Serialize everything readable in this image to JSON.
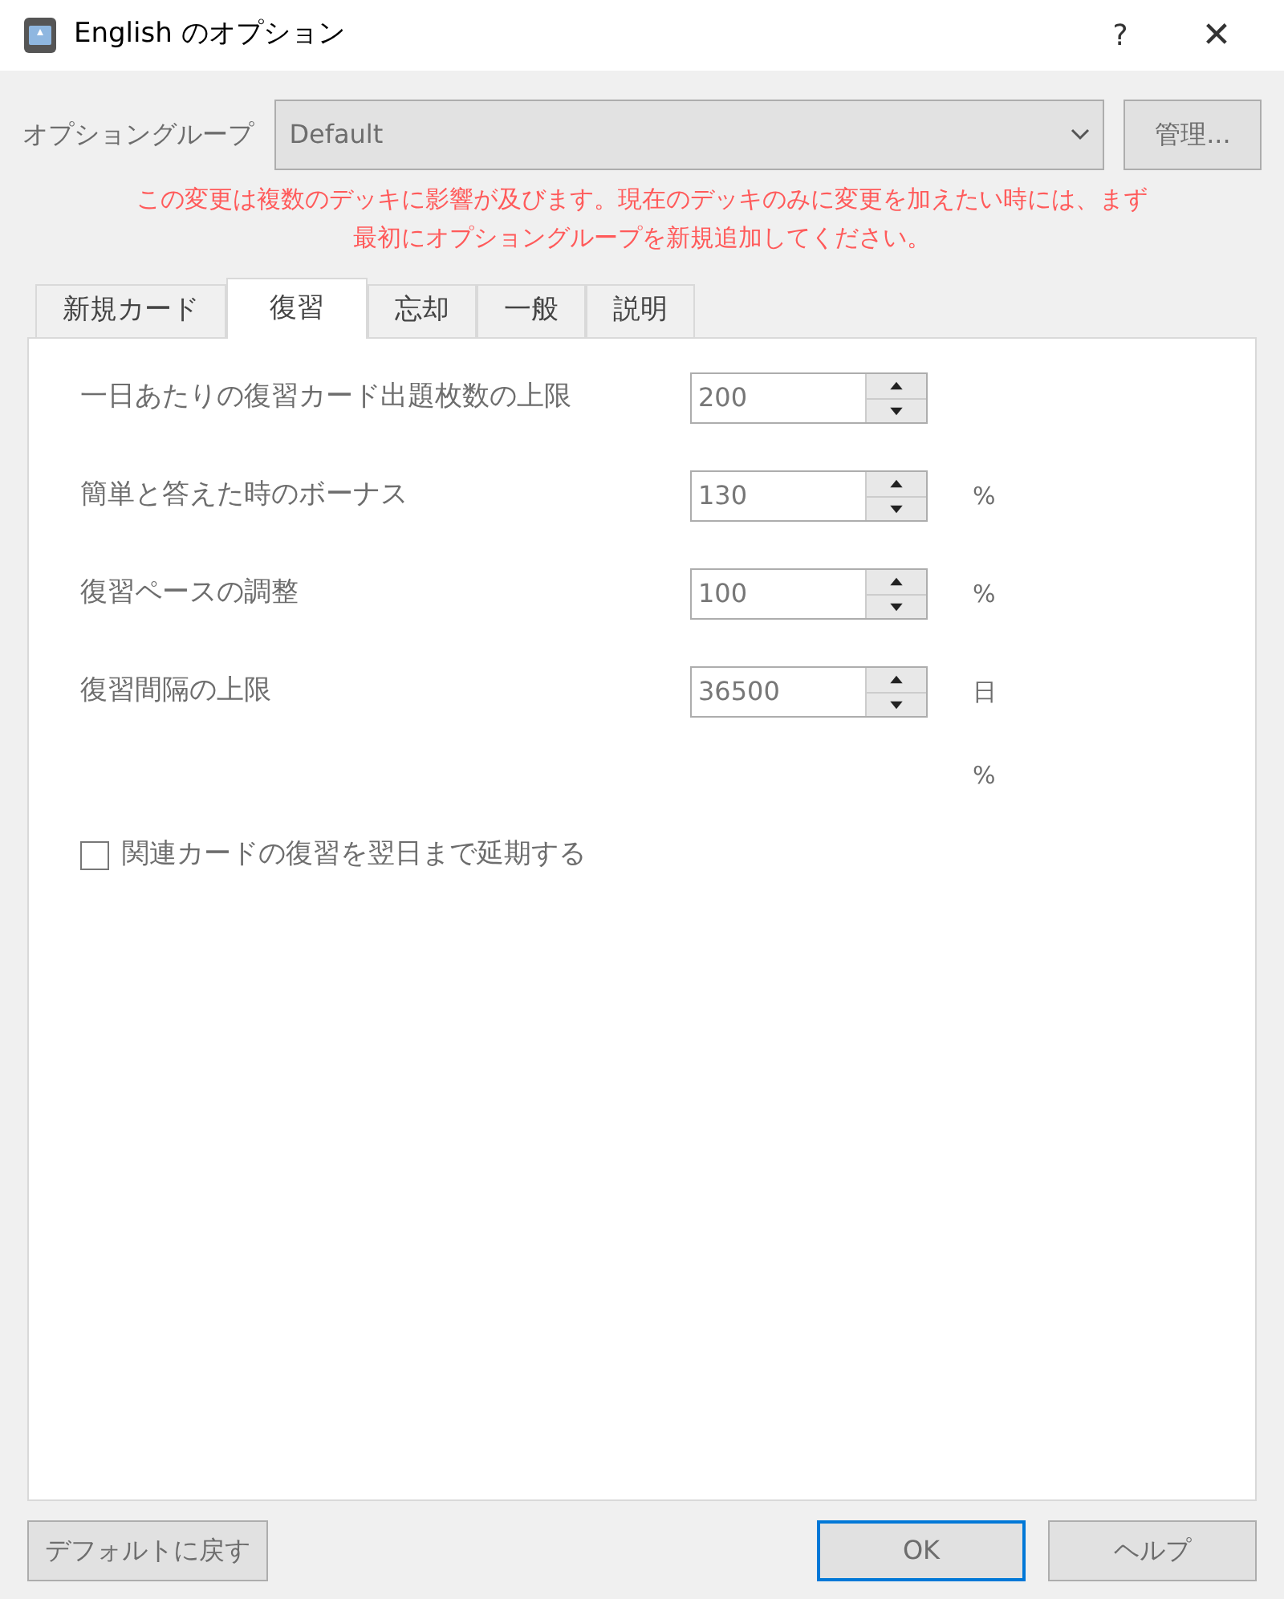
{
  "window": {
    "title": "English のオプション",
    "help": "?",
    "close": "✕"
  },
  "option_group": {
    "label": "オプショングループ",
    "value": "Default",
    "manage_button": "管理..."
  },
  "warning": [
    "この変更は複数のデッキに影響が及びます。現在のデッキのみに変更を加えたい時には、まず",
    "最初にオプショングループを新規追加してください。"
  ],
  "tabs": [
    {
      "label": "新規カード",
      "selected": false
    },
    {
      "label": "復習",
      "selected": true
    },
    {
      "label": "忘却",
      "selected": false
    },
    {
      "label": "一般",
      "selected": false
    },
    {
      "label": "説明",
      "selected": false
    }
  ],
  "fields": [
    {
      "label": "一日あたりの復習カード出題枚数の上限",
      "value": "200"
    },
    {
      "label": "簡単と答えた時のボーナス",
      "value": "130",
      "unit": "%"
    },
    {
      "label": "復習ペースの調整",
      "value": "100",
      "unit": "%"
    },
    {
      "label": "復習間隔の上限",
      "value": "36500",
      "unit": "日"
    }
  ],
  "extra_unit": "%",
  "bury_checkbox": {
    "label": "関連カードの復習を翌日まで延期する",
    "checked": false
  },
  "left_buttons": [
    {
      "label": "デフォルトに戻す",
      "default": false
    }
  ],
  "right_buttons": [
    {
      "label": "OK",
      "default": true
    },
    {
      "label": "ヘルプ",
      "default": false
    }
  ]
}
